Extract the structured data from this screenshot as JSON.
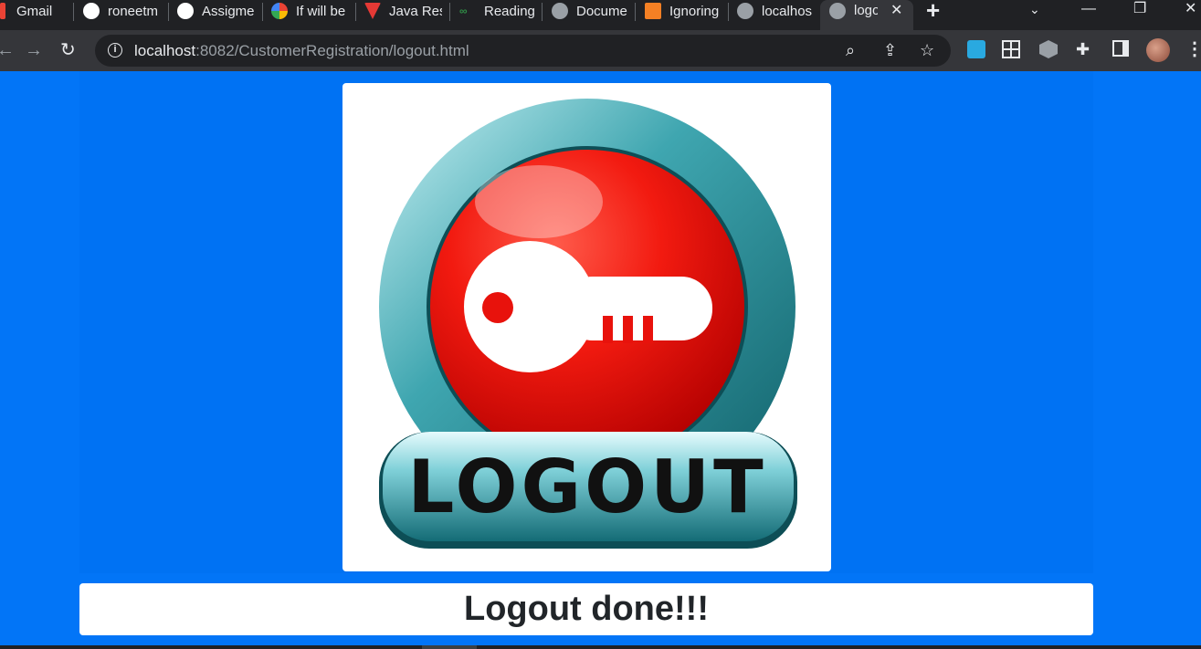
{
  "browser": {
    "tabs": [
      {
        "title": "Gmail",
        "icon": "gmail-icon",
        "color": "#ea4335"
      },
      {
        "title": "roneetm",
        "icon": "github-icon",
        "color": "#ffffff"
      },
      {
        "title": "Assigme",
        "icon": "github-icon",
        "color": "#ffffff"
      },
      {
        "title": "If will be",
        "icon": "google-icon",
        "color": "#4285f4"
      },
      {
        "title": "Java Res",
        "icon": "java-res-icon",
        "color": "#e53935"
      },
      {
        "title": "Reading",
        "icon": "geeksforgeeks-icon",
        "color": "#2f8d46"
      },
      {
        "title": "Docume",
        "icon": "globe-icon",
        "color": "#9aa0a6"
      },
      {
        "title": "Ignoring",
        "icon": "stackoverflow-icon",
        "color": "#f48024"
      },
      {
        "title": "localhos",
        "icon": "globe-icon",
        "color": "#9aa0a6"
      },
      {
        "title": "logo",
        "icon": "globe-icon",
        "color": "#9aa0a6",
        "active": true
      }
    ],
    "address": {
      "host": "localhost",
      "path": ":8082/CustomerRegistration/logout.html"
    }
  },
  "page": {
    "logo_alt": "LOGOUT",
    "logo_text": "LOGOUT",
    "message": "Logout done!!!",
    "colors": {
      "background": "#0275f7",
      "card": "#ffffff",
      "button_red": "#e8120c",
      "ring_teal": "#3fa6b0"
    }
  }
}
